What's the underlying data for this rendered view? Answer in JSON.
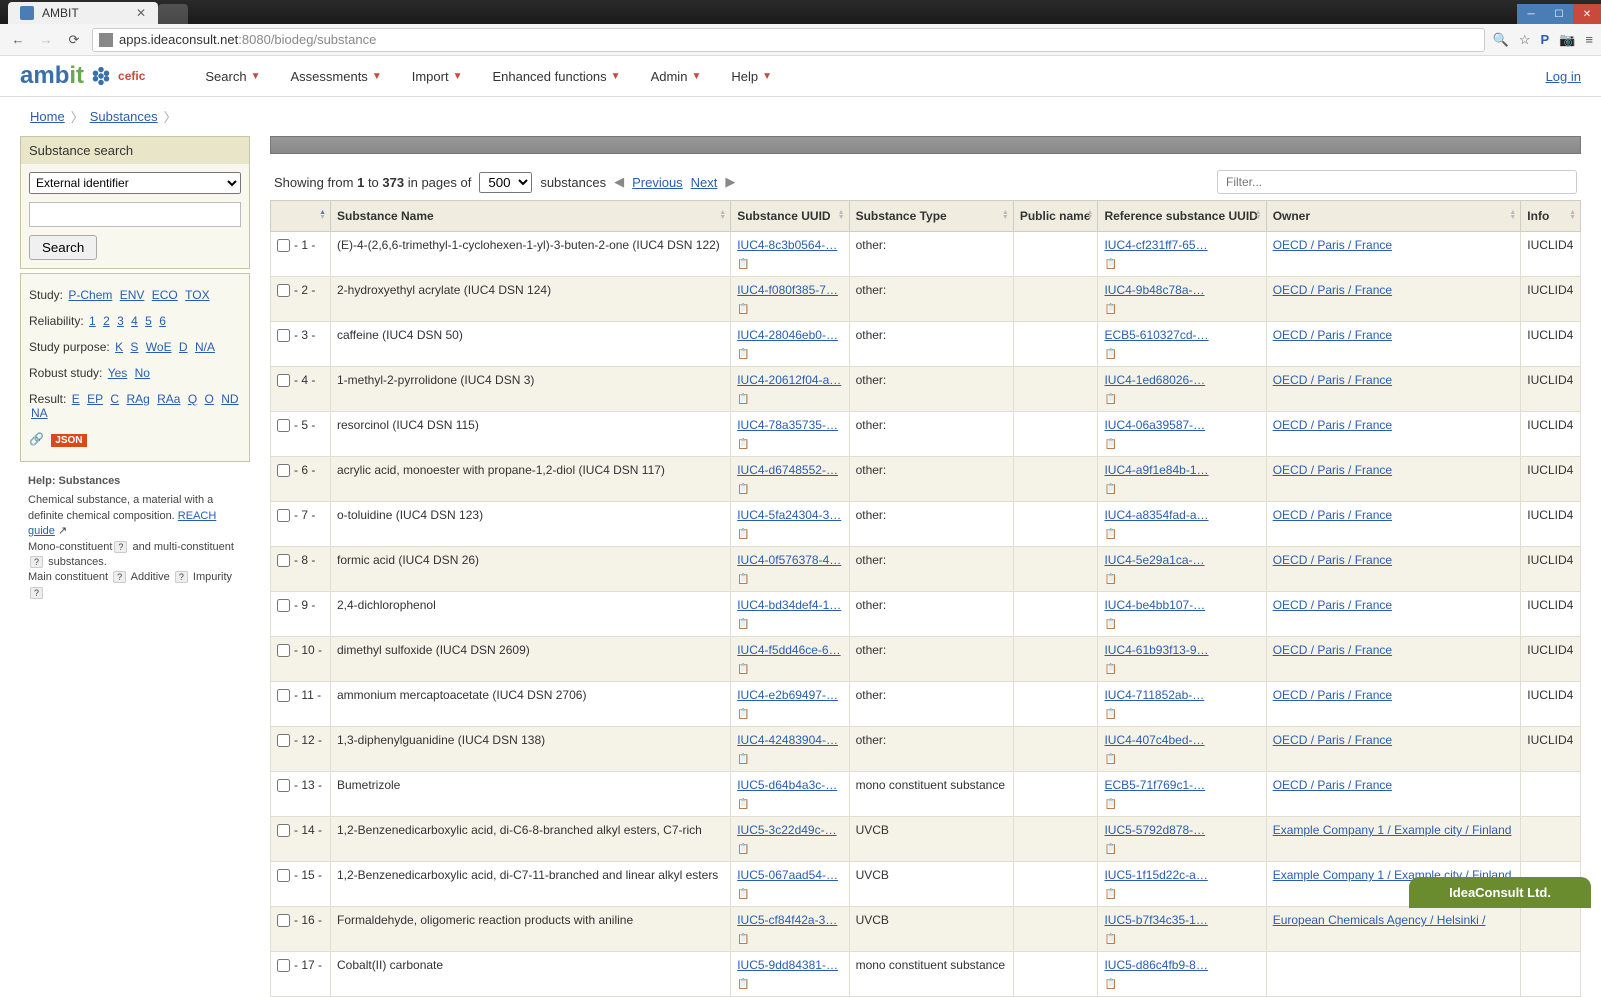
{
  "browser": {
    "tab_title": "AMBIT",
    "url_host": "apps.ideaconsult.net",
    "url_port": ":8080",
    "url_path": "/biodeg/substance"
  },
  "header": {
    "nav": [
      "Search",
      "Assessments",
      "Import",
      "Enhanced functions",
      "Admin",
      "Help"
    ],
    "login": "Log in"
  },
  "breadcrumb": {
    "home": "Home",
    "current": "Substances"
  },
  "sidebar": {
    "search_title": "Substance search",
    "select_value": "External identifier",
    "search_button": "Search",
    "study_label": "Study:",
    "study_links": [
      "P-Chem",
      "ENV",
      "ECO",
      "TOX"
    ],
    "reliability_label": "Reliability:",
    "reliability_links": [
      "1",
      "2",
      "3",
      "4",
      "5",
      "6"
    ],
    "purpose_label": "Study purpose:",
    "purpose_links": [
      "K",
      "S",
      "WoE",
      "D",
      "N/A"
    ],
    "robust_label": "Robust study:",
    "robust_links": [
      "Yes",
      "No"
    ],
    "result_label": "Result:",
    "result_links": [
      "E",
      "EP",
      "C",
      "RAg",
      "RAa",
      "Q",
      "O",
      "ND",
      "NA"
    ],
    "json_badge": "JSON",
    "help_title": "Help: Substances",
    "help_body": "Chemical substance, a material with a definite chemical composition. ",
    "help_link": "REACH guide",
    "help_row2_a": "Mono-constituent",
    "help_row2_b": " and multi-constituent ",
    "help_row2_c": " substances.",
    "help_row3_a": "Main constituent ",
    "help_row3_b": " Additive ",
    "help_row3_c": " Impurity "
  },
  "controls": {
    "showing_prefix": "Showing from ",
    "from": "1",
    "to_word": " to ",
    "to": "373",
    "in_pages": " in pages of ",
    "page_size": "500",
    "substances_word": " substances ",
    "previous": "Previous",
    "next": "Next",
    "filter_placeholder": "Filter..."
  },
  "columns": [
    "",
    "Substance Name",
    "Substance UUID",
    "Substance Type",
    "Public name",
    "Reference substance UUID",
    "Owner",
    "Info"
  ],
  "rows": [
    {
      "idx": "- 1 -",
      "name": "(E)-4-(2,6,6-trimethyl-1-cyclohexen-1-yl)-3-buten-2-one (IUC4 DSN 122)",
      "uuid": "IUC4-8c3b0564-…",
      "type": "other:",
      "ref": "IUC4-cf231ff7-65…",
      "owner": "OECD / Paris / France",
      "info": "IUCLID4"
    },
    {
      "idx": "- 2 -",
      "name": "2-hydroxyethyl acrylate (IUC4 DSN 124)",
      "uuid": "IUC4-f080f385-7…",
      "type": "other:",
      "ref": "IUC4-9b48c78a-…",
      "owner": "OECD / Paris / France",
      "info": "IUCLID4"
    },
    {
      "idx": "- 3 -",
      "name": "caffeine (IUC4 DSN 50)",
      "uuid": "IUC4-28046eb0-…",
      "type": "other:",
      "ref": "ECB5-610327cd-…",
      "owner": "OECD / Paris / France",
      "info": "IUCLID4"
    },
    {
      "idx": "- 4 -",
      "name": "1-methyl-2-pyrrolidone (IUC4 DSN 3)",
      "uuid": "IUC4-20612f04-a…",
      "type": "other:",
      "ref": "IUC4-1ed68026-…",
      "owner": "OECD / Paris / France",
      "info": "IUCLID4"
    },
    {
      "idx": "- 5 -",
      "name": "resorcinol (IUC4 DSN 115)",
      "uuid": "IUC4-78a35735-…",
      "type": "other:",
      "ref": "IUC4-06a39587-…",
      "owner": "OECD / Paris / France",
      "info": "IUCLID4"
    },
    {
      "idx": "- 6 -",
      "name": "acrylic acid, monoester with propane-1,2-diol (IUC4 DSN 117)",
      "uuid": "IUC4-d6748552-…",
      "type": "other:",
      "ref": "IUC4-a9f1e84b-1…",
      "owner": "OECD / Paris / France",
      "info": "IUCLID4"
    },
    {
      "idx": "- 7 -",
      "name": "o-toluidine (IUC4 DSN 123)",
      "uuid": "IUC4-5fa24304-3…",
      "type": "other:",
      "ref": "IUC4-a8354fad-a…",
      "owner": "OECD / Paris / France",
      "info": "IUCLID4"
    },
    {
      "idx": "- 8 -",
      "name": "formic acid (IUC4 DSN 26)",
      "uuid": "IUC4-0f576378-4…",
      "type": "other:",
      "ref": "IUC4-5e29a1ca-…",
      "owner": "OECD / Paris / France",
      "info": "IUCLID4"
    },
    {
      "idx": "- 9 -",
      "name": "2,4-dichlorophenol",
      "uuid": "IUC4-bd34def4-1…",
      "type": "other:",
      "ref": "IUC4-be4bb107-…",
      "owner": "OECD / Paris / France",
      "info": "IUCLID4"
    },
    {
      "idx": "- 10 -",
      "name": "dimethyl sulfoxide (IUC4 DSN 2609)",
      "uuid": "IUC4-f5dd46ce-6…",
      "type": "other:",
      "ref": "IUC4-61b93f13-9…",
      "owner": "OECD / Paris / France",
      "info": "IUCLID4"
    },
    {
      "idx": "- 11 -",
      "name": "ammonium mercaptoacetate (IUC4 DSN 2706)",
      "uuid": "IUC4-e2b69497-…",
      "type": "other:",
      "ref": "IUC4-711852ab-…",
      "owner": "OECD / Paris / France",
      "info": "IUCLID4"
    },
    {
      "idx": "- 12 -",
      "name": "1,3-diphenylguanidine (IUC4 DSN 138)",
      "uuid": "IUC4-42483904-…",
      "type": "other:",
      "ref": "IUC4-407c4bed-…",
      "owner": "OECD / Paris / France",
      "info": "IUCLID4"
    },
    {
      "idx": "- 13 -",
      "name": "Bumetrizole",
      "uuid": "IUC5-d64b4a3c-…",
      "type": "mono constituent substance",
      "ref": "ECB5-71f769c1-…",
      "owner": "OECD / Paris / France",
      "info": ""
    },
    {
      "idx": "- 14 -",
      "name": "1,2-Benzenedicarboxylic acid, di-C6-8-branched alkyl esters, C7-rich",
      "uuid": "IUC5-3c22d49c-…",
      "type": "UVCB",
      "ref": "IUC5-5792d878-…",
      "owner": "Example Company 1 / Example city / Finland",
      "info": ""
    },
    {
      "idx": "- 15 -",
      "name": "1,2-Benzenedicarboxylic acid, di-C7-11-branched and linear alkyl esters",
      "uuid": "IUC5-067aad54-…",
      "type": "UVCB",
      "ref": "IUC5-1f15d22c-a…",
      "owner": "Example Company 1 / Example city / Finland",
      "info": ""
    },
    {
      "idx": "- 16 -",
      "name": "Formaldehyde, oligomeric reaction products with aniline",
      "uuid": "IUC5-cf84f42a-3…",
      "type": "UVCB",
      "ref": "IUC5-b7f34c35-1…",
      "owner": "European Chemicals Agency / Helsinki /",
      "info": ""
    },
    {
      "idx": "- 17 -",
      "name": "Cobalt(II) carbonate",
      "uuid": "IUC5-9dd84381-…",
      "type": "mono constituent substance",
      "ref": "IUC5-d86c4fb9-8…",
      "owner": "",
      "info": ""
    }
  ],
  "footer": {
    "company": "IdeaConsult Ltd."
  }
}
